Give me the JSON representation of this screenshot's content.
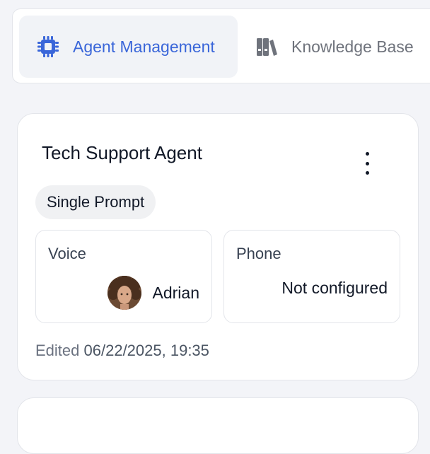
{
  "nav": {
    "tabs": [
      {
        "label": "Agent Management",
        "icon": "chip-icon",
        "active": true
      },
      {
        "label": "Knowledge Base",
        "icon": "books-icon",
        "active": false
      }
    ],
    "accent": "#3a66d9"
  },
  "agent_card": {
    "title": "Tech Support Agent",
    "type_badge": "Single Prompt",
    "voice": {
      "label": "Voice",
      "value": "Adrian"
    },
    "phone": {
      "label": "Phone",
      "value": "Not configured"
    },
    "edited_label": "Edited",
    "edited_value": "06/22/2025, 19:35"
  }
}
